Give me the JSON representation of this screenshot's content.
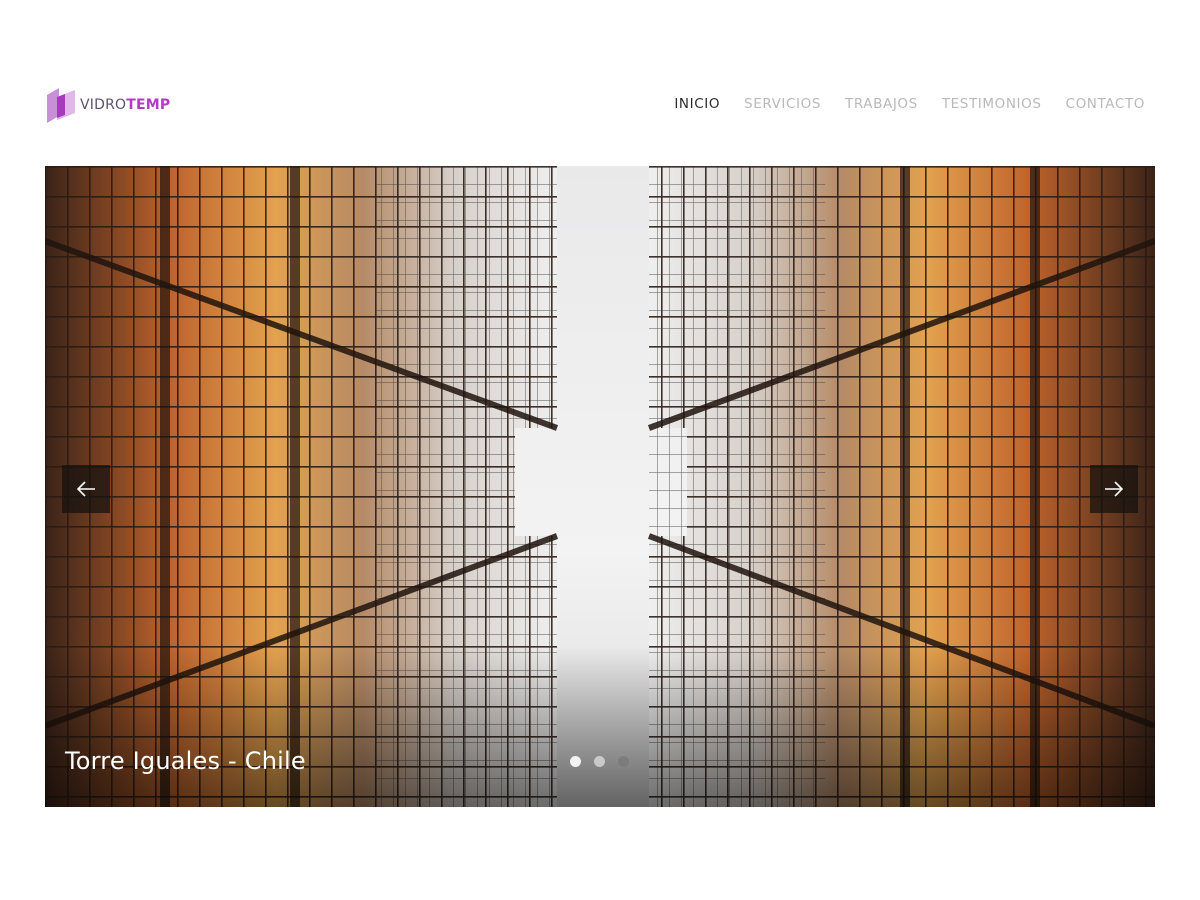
{
  "brand": {
    "name_part1": "VIDRO",
    "name_part2": "TEMP",
    "logo_icon": "glass-panels-logo",
    "color_primary": "#b33bc4",
    "color_secondary": "#5b5370"
  },
  "nav": {
    "items": [
      {
        "label": "INICIO",
        "active": true
      },
      {
        "label": "SERVICIOS",
        "active": false
      },
      {
        "label": "TRABAJOS",
        "active": false
      },
      {
        "label": "TESTIMONIOS",
        "active": false
      },
      {
        "label": "CONTACTO",
        "active": false
      }
    ],
    "active_color": "#2a2a2a",
    "inactive_color": "#b9b9b9"
  },
  "slider": {
    "caption": "Torre Iguales - Chile",
    "image_subject": "looking up between two glass skyscrapers",
    "prev_icon": "arrow-left-icon",
    "next_icon": "arrow-right-icon",
    "slide_count": 3,
    "current_slide": 1
  }
}
